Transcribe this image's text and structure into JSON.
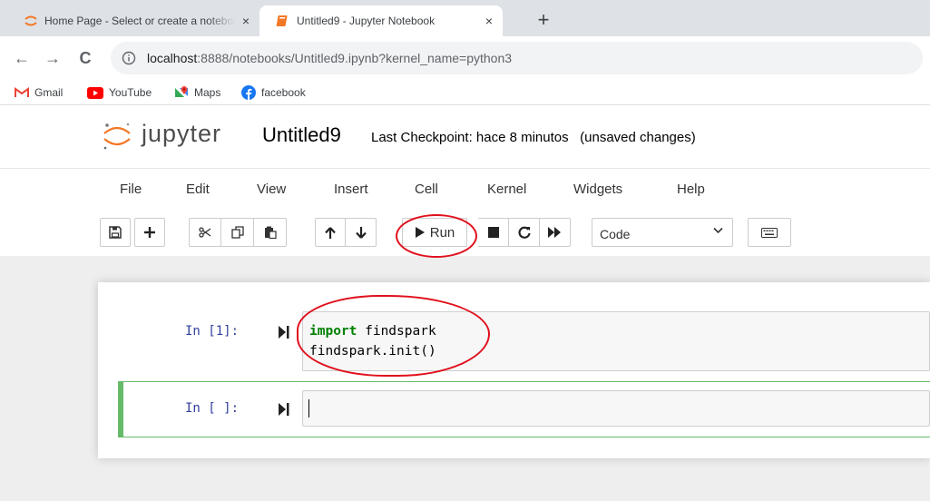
{
  "browser": {
    "tabs": [
      {
        "title": "Home Page - Select or create a notebook",
        "active": false,
        "close": "×"
      },
      {
        "title": "Untitled9 - Jupyter Notebook",
        "active": true,
        "close": "×"
      }
    ],
    "new_tab": "+",
    "back": "←",
    "forward": "→",
    "reload": "C",
    "url_host": "localhost",
    "url_rest": ":8888/notebooks/Untitled9.ipynb?kernel_name=python3",
    "bookmarks": [
      {
        "label": "Gmail",
        "icon": "gmail-icon"
      },
      {
        "label": "YouTube",
        "icon": "youtube-icon"
      },
      {
        "label": "Maps",
        "icon": "maps-icon"
      },
      {
        "label": "facebook",
        "icon": "facebook-icon"
      }
    ]
  },
  "jupyter": {
    "wordmark": "jupyter",
    "notebook_name": "Untitled9",
    "checkpoint": "Last Checkpoint: hace 8 minutos",
    "unsaved": "(unsaved changes)",
    "menu": [
      "File",
      "Edit",
      "View",
      "Insert",
      "Cell",
      "Kernel",
      "Widgets",
      "Help"
    ],
    "toolbar": {
      "run_label": "Run",
      "cell_type": "Code",
      "icons": [
        "save-icon",
        "plus-icon",
        "cut-icon",
        "copy-icon",
        "paste-icon",
        "arrow-up-icon",
        "arrow-down-icon",
        "run-icon",
        "stop-icon",
        "restart-icon",
        "fast-forward-icon",
        "keyboard-icon"
      ]
    },
    "cells": [
      {
        "prompt": "In [1]:",
        "lines": [
          {
            "kw": "import",
            "rest": " findspark"
          },
          {
            "kw": "",
            "rest": "findspark.init()"
          }
        ]
      },
      {
        "prompt": "In [ ]:",
        "lines": []
      }
    ]
  },
  "colors": {
    "annotation": "#e0101c",
    "selected_cell": "#66bb6a",
    "prompt": "#303f9f",
    "keyword": "#008000"
  }
}
